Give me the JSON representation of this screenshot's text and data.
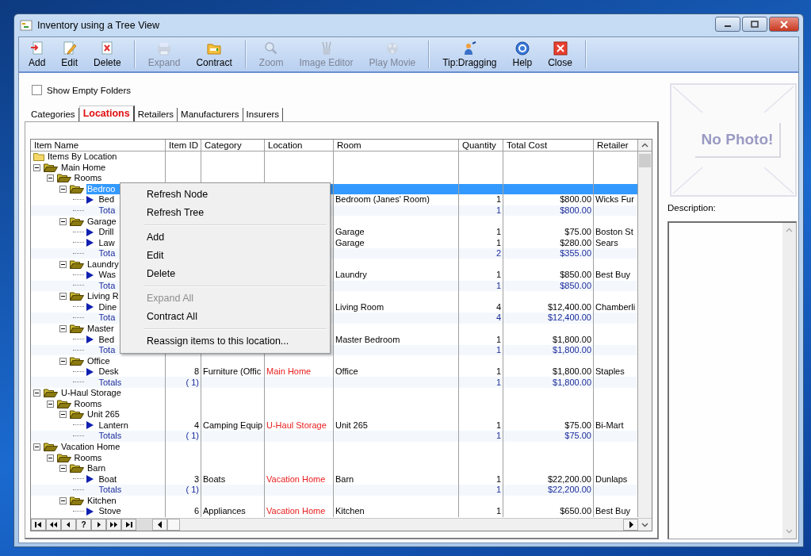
{
  "window": {
    "title": "Inventory using a Tree View"
  },
  "toolbar": [
    {
      "kind": "add",
      "label": "Add",
      "disabled": false
    },
    {
      "kind": "edit",
      "label": "Edit",
      "disabled": false
    },
    {
      "kind": "delete",
      "label": "Delete",
      "disabled": false
    },
    {
      "kind": "separator"
    },
    {
      "kind": "expand",
      "label": "Expand",
      "disabled": true
    },
    {
      "kind": "contract",
      "label": "Contract",
      "disabled": false
    },
    {
      "kind": "separator"
    },
    {
      "kind": "zoom",
      "label": "Zoom",
      "disabled": true
    },
    {
      "kind": "image_editor",
      "label": "Image Editor",
      "disabled": true
    },
    {
      "kind": "play_movie",
      "label": "Play Movie",
      "disabled": true
    },
    {
      "kind": "separator"
    },
    {
      "kind": "tip",
      "label": "Tip:Dragging",
      "disabled": false
    },
    {
      "kind": "help",
      "label": "Help",
      "disabled": false
    },
    {
      "kind": "close",
      "label": "Close",
      "disabled": false
    },
    {
      "kind": "separator"
    }
  ],
  "show_empty_folders": {
    "label": "Show Empty Folders",
    "checked": false
  },
  "tabs": [
    {
      "label": "Categories",
      "selected": false
    },
    {
      "label": "Locations",
      "selected": true
    },
    {
      "label": "Retailers",
      "selected": false
    },
    {
      "label": "Manufacturers",
      "selected": false
    },
    {
      "label": "Insurers",
      "selected": false
    }
  ],
  "grid": {
    "columns": [
      "Item Name",
      "Item ID",
      "Category",
      "Location",
      "Room",
      "Quantity",
      "Total Cost",
      "Retailer"
    ],
    "rows": [
      {
        "kind": "root",
        "name": "Items By Location",
        "selected": false,
        "children": [
          {
            "kind": "folder",
            "name": "Main Home",
            "expanded": true,
            "selected": false,
            "children": [
              {
                "kind": "folder",
                "name": "Rooms",
                "expanded": true,
                "selected": false,
                "children": [
                  {
                    "kind": "folder",
                    "name": "Bedroo",
                    "expanded": true,
                    "selected": true,
                    "children": [
                      {
                        "kind": "item",
                        "name": "Bed",
                        "room": "Bedroom (Janes' Room)",
                        "quantity": "1",
                        "total_cost": "$800.00",
                        "retailer": "Wicks Fur",
                        "selected": false
                      },
                      {
                        "kind": "totals",
                        "name": "Tota",
                        "quantity": "1",
                        "total_cost": "$800.00",
                        "selected": false
                      }
                    ]
                  },
                  {
                    "kind": "folder",
                    "name": "Garage",
                    "expanded": true,
                    "selected": false,
                    "children": [
                      {
                        "kind": "item",
                        "name": "Drill",
                        "room": "Garage",
                        "quantity": "1",
                        "total_cost": "$75.00",
                        "retailer": "Boston St",
                        "selected": false
                      },
                      {
                        "kind": "item",
                        "name": "Law",
                        "room": "Garage",
                        "quantity": "1",
                        "total_cost": "$280.00",
                        "retailer": "Sears",
                        "selected": false
                      },
                      {
                        "kind": "totals",
                        "name": "Tota",
                        "quantity": "2",
                        "total_cost": "$355.00",
                        "selected": false
                      }
                    ]
                  },
                  {
                    "kind": "folder",
                    "name": "Laundry",
                    "expanded": true,
                    "selected": false,
                    "children": [
                      {
                        "kind": "item",
                        "name": "Was",
                        "room": "Laundry",
                        "quantity": "1",
                        "total_cost": "$850.00",
                        "retailer": "Best Buy",
                        "selected": false
                      },
                      {
                        "kind": "totals",
                        "name": "Tota",
                        "quantity": "1",
                        "total_cost": "$850.00",
                        "selected": false
                      }
                    ]
                  },
                  {
                    "kind": "folder",
                    "name": "Living R",
                    "expanded": true,
                    "selected": false,
                    "children": [
                      {
                        "kind": "item",
                        "name": "Dine",
                        "room": "Living Room",
                        "quantity": "4",
                        "total_cost": "$12,400.00",
                        "retailer": "Chamberli",
                        "selected": false
                      },
                      {
                        "kind": "totals",
                        "name": "Tota",
                        "quantity": "4",
                        "total_cost": "$12,400.00",
                        "selected": false
                      }
                    ]
                  },
                  {
                    "kind": "folder",
                    "name": "Master",
                    "expanded": true,
                    "selected": false,
                    "children": [
                      {
                        "kind": "item",
                        "name": "Bed",
                        "room": "Master Bedroom",
                        "quantity": "1",
                        "total_cost": "$1,800.00",
                        "selected": false
                      },
                      {
                        "kind": "totals",
                        "name": "Tota",
                        "quantity": "1",
                        "total_cost": "$1,800.00",
                        "selected": false
                      }
                    ]
                  },
                  {
                    "kind": "folder",
                    "name": "Office",
                    "expanded": true,
                    "selected": false,
                    "children": [
                      {
                        "kind": "item",
                        "name": "Desk",
                        "item_id": "8",
                        "category": "Furniture (Offic",
                        "location": "Main Home",
                        "room": "Office",
                        "quantity": "1",
                        "total_cost": "$1,800.00",
                        "retailer": "Staples",
                        "selected": false
                      },
                      {
                        "kind": "totals",
                        "name": "Totals",
                        "item_id": "(  1)",
                        "quantity": "1",
                        "total_cost": "$1,800.00",
                        "selected": false
                      }
                    ]
                  }
                ]
              }
            ]
          },
          {
            "kind": "folder",
            "name": "U-Haul Storage",
            "expanded": true,
            "selected": false,
            "children": [
              {
                "kind": "folder",
                "name": "Rooms",
                "expanded": true,
                "selected": false,
                "children": [
                  {
                    "kind": "folder",
                    "name": "Unit 265",
                    "expanded": true,
                    "selected": false,
                    "children": [
                      {
                        "kind": "item",
                        "name": "Lantern",
                        "item_id": "4",
                        "category": "Camping Equip",
                        "location": "U-Haul Storage",
                        "room": "Unit 265",
                        "quantity": "1",
                        "total_cost": "$75.00",
                        "retailer": "Bi-Mart",
                        "selected": false
                      },
                      {
                        "kind": "totals",
                        "name": "Totals",
                        "item_id": "(  1)",
                        "quantity": "1",
                        "total_cost": "$75.00",
                        "selected": false
                      }
                    ]
                  }
                ]
              }
            ]
          },
          {
            "kind": "folder",
            "name": "Vacation Home",
            "expanded": true,
            "selected": false,
            "children": [
              {
                "kind": "folder",
                "name": "Rooms",
                "expanded": true,
                "selected": false,
                "children": [
                  {
                    "kind": "folder",
                    "name": "Barn",
                    "expanded": true,
                    "selected": false,
                    "children": [
                      {
                        "kind": "item",
                        "name": "Boat",
                        "item_id": "3",
                        "category": "Boats",
                        "location": "Vacation Home",
                        "room": "Barn",
                        "quantity": "1",
                        "total_cost": "$22,200.00",
                        "retailer": "Dunlaps",
                        "selected": false
                      },
                      {
                        "kind": "totals",
                        "name": "Totals",
                        "item_id": "(  1)",
                        "quantity": "1",
                        "total_cost": "$22,200.00",
                        "selected": false
                      }
                    ]
                  },
                  {
                    "kind": "folder",
                    "name": "Kitchen",
                    "expanded": true,
                    "selected": false,
                    "children": [
                      {
                        "kind": "item",
                        "name": "Stove",
                        "item_id": "6",
                        "category": "Appliances",
                        "location": "Vacation Home",
                        "room": "Kitchen",
                        "quantity": "1",
                        "total_cost": "$650.00",
                        "retailer": "Best Buy",
                        "selected": false
                      }
                    ]
                  }
                ]
              }
            ]
          }
        ]
      }
    ]
  },
  "navigator": [
    {
      "kind": "first"
    },
    {
      "kind": "prev_page"
    },
    {
      "kind": "prev"
    },
    {
      "kind": "text",
      "label": "?"
    },
    {
      "kind": "next"
    },
    {
      "kind": "next_page"
    },
    {
      "kind": "last"
    }
  ],
  "photo": {
    "text": "No Photo!"
  },
  "description": {
    "label": "Description:"
  },
  "context_menu": [
    {
      "kind": "item",
      "label": "Refresh Node",
      "disabled": false
    },
    {
      "kind": "item",
      "label": "Refresh Tree",
      "disabled": false
    },
    {
      "kind": "separator"
    },
    {
      "kind": "item",
      "label": "Add",
      "disabled": false
    },
    {
      "kind": "item",
      "label": "Edit",
      "disabled": false
    },
    {
      "kind": "item",
      "label": "Delete",
      "disabled": false
    },
    {
      "kind": "separator"
    },
    {
      "kind": "item",
      "label": "Expand All",
      "disabled": true
    },
    {
      "kind": "item",
      "label": "Contract All",
      "disabled": false
    },
    {
      "kind": "separator"
    },
    {
      "kind": "item",
      "label": "Reassign items to this location...",
      "disabled": false
    }
  ]
}
